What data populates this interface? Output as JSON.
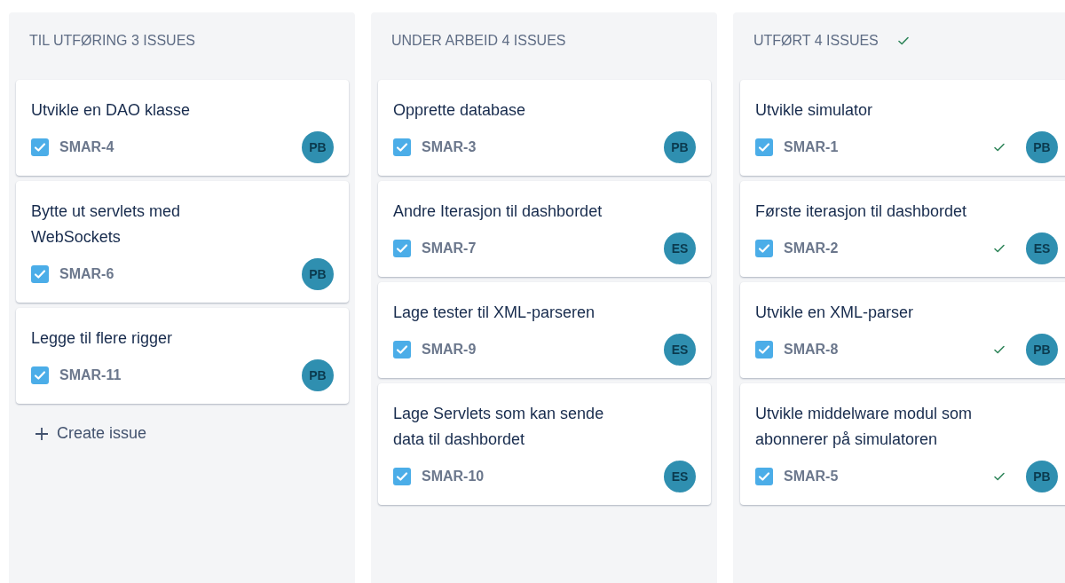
{
  "columns": [
    {
      "title": "TIL UTFØRING 3 ISSUES",
      "done": false,
      "cards": [
        {
          "title": "Utvikle en DAO klasse",
          "key": "SMAR-4",
          "assignee": "PB",
          "resolved": false
        },
        {
          "title": "Bytte ut servlets med WebSockets",
          "key": "SMAR-6",
          "assignee": "PB",
          "resolved": false
        },
        {
          "title": "Legge til flere rigger",
          "key": "SMAR-11",
          "assignee": "PB",
          "resolved": false
        }
      ],
      "create": "Create issue"
    },
    {
      "title": "UNDER ARBEID 4 ISSUES",
      "done": false,
      "cards": [
        {
          "title": "Opprette database",
          "key": "SMAR-3",
          "assignee": "PB",
          "resolved": false
        },
        {
          "title": "Andre Iterasjon til dashbordet",
          "key": "SMAR-7",
          "assignee": "ES",
          "resolved": false
        },
        {
          "title": "Lage tester til XML-parseren",
          "key": "SMAR-9",
          "assignee": "ES",
          "resolved": false
        },
        {
          "title": "Lage Servlets som kan sende data til dashbordet",
          "key": "SMAR-10",
          "assignee": "ES",
          "resolved": false
        }
      ]
    },
    {
      "title": "UTFØRT 4 ISSUES",
      "done": true,
      "cards": [
        {
          "title": "Utvikle simulator",
          "key": "SMAR-1",
          "assignee": "PB",
          "resolved": true
        },
        {
          "title": "Første iterasjon til dashbordet",
          "key": "SMAR-2",
          "assignee": "ES",
          "resolved": true
        },
        {
          "title": "Utvikle en XML-parser",
          "key": "SMAR-8",
          "assignee": "PB",
          "resolved": true
        },
        {
          "title": "Utvikle middelware modul som abonnerer på simulatoren",
          "key": "SMAR-5",
          "assignee": "PB",
          "resolved": true
        }
      ]
    }
  ]
}
